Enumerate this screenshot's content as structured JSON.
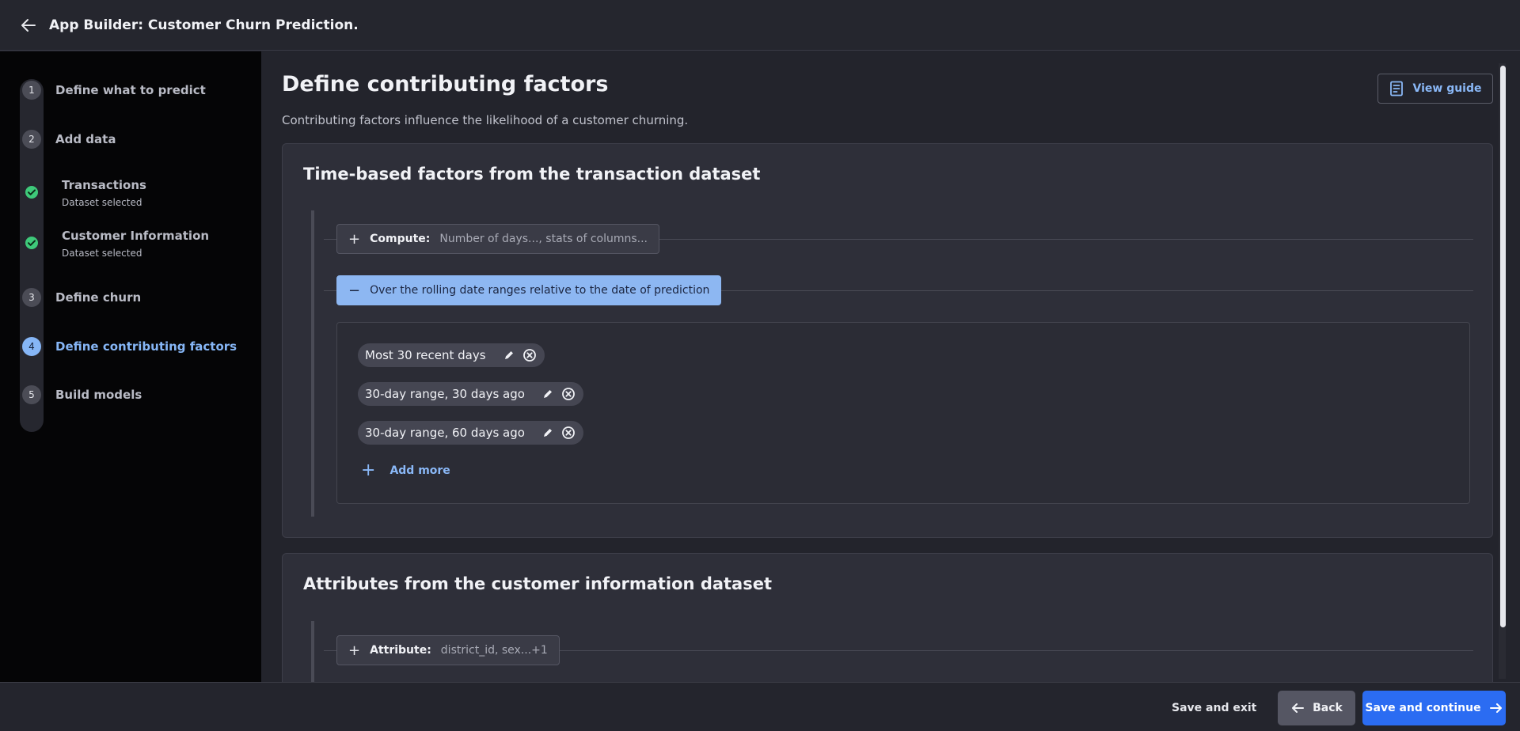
{
  "app": {
    "title": "App Builder: Customer Churn Prediction."
  },
  "steps": [
    {
      "number": "1",
      "label": "Define what to predict",
      "status": "default"
    },
    {
      "number": "2",
      "label": "Add data",
      "status": "default"
    },
    {
      "number": "3",
      "label": "Define churn",
      "status": "default"
    },
    {
      "number": "4",
      "label": "Define contributing factors",
      "status": "active"
    },
    {
      "number": "5",
      "label": "Build models",
      "status": "default"
    }
  ],
  "substeps": [
    {
      "title": "Transactions",
      "subtitle": "Dataset selected"
    },
    {
      "title": "Customer Information",
      "subtitle": "Dataset selected"
    }
  ],
  "page": {
    "title": "Define contributing factors",
    "subtitle": "Contributing factors influence the likelihood of a customer churning.",
    "guide_label": "View guide"
  },
  "time_card": {
    "title": "Time-based factors from the transaction dataset",
    "compute": {
      "key": "Compute:",
      "value": "Number of days..., stats of columns..."
    },
    "rolling": {
      "label": "Over the rolling date ranges relative to the date of prediction"
    },
    "ranges": [
      "Most 30 recent days",
      "30-day range, 30 days ago",
      "30-day range, 60 days ago"
    ],
    "add_more": "Add more"
  },
  "attr_card": {
    "title": "Attributes from the customer information dataset",
    "attribute": {
      "key": "Attribute:",
      "value": "district_id, sex...+1"
    }
  },
  "footer": {
    "save_exit": "Save and exit",
    "back": "Back",
    "continue": "Save and continue"
  },
  "colors": {
    "accent": "#86b6f6",
    "primary_button": "#2b6cf2",
    "success": "#3ec97a"
  }
}
